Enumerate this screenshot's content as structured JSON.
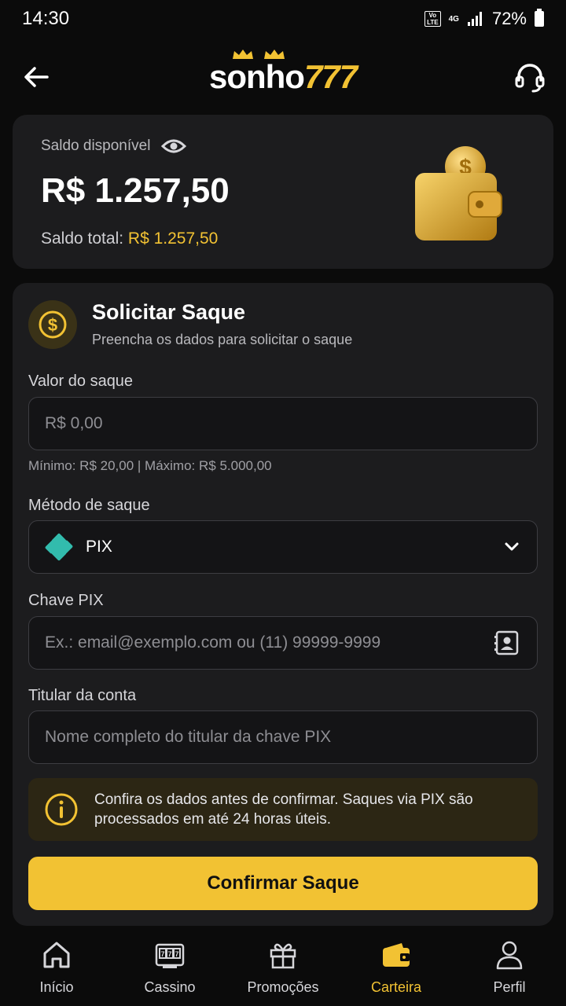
{
  "status_bar": {
    "time": "14:30",
    "volte": "Vo LTE",
    "network": "4G",
    "battery": "72%"
  },
  "header": {
    "logo_main": "sonho",
    "logo_num": "777"
  },
  "balance": {
    "label": "Saldo disponível",
    "amount": "R$ 1.257,50",
    "total_label": "Saldo total:",
    "total_value": "R$ 1.257,50"
  },
  "form": {
    "title": "Solicitar Saque",
    "subtitle": "Preencha os dados para solicitar o saque",
    "amount_label": "Valor do saque",
    "amount_placeholder": "R$ 0,00",
    "amount_hint": "Mínimo: R$ 20,00 | Máximo: R$ 5.000,00",
    "method_label": "Método de saque",
    "method_value": "PIX",
    "pix_label": "Chave PIX",
    "pix_placeholder": "Ex.: email@exemplo.com ou (11) 99999-9999",
    "holder_label": "Titular da conta",
    "holder_placeholder": "Nome completo do titular da chave PIX",
    "notice": "Confira os dados antes de confirmar. Saques via PIX são processados em até 24 horas úteis.",
    "confirm_label": "Confirmar Saque"
  },
  "nav": [
    {
      "label": "Início",
      "icon": "home-icon"
    },
    {
      "label": "Cassino",
      "icon": "slot-machine-icon"
    },
    {
      "label": "Promoções",
      "icon": "gift-icon"
    },
    {
      "label": "Carteira",
      "icon": "wallet-icon",
      "active": true
    },
    {
      "label": "Perfil",
      "icon": "user-icon"
    }
  ],
  "colors": {
    "accent": "#f2c233",
    "background": "#0b0b0b",
    "card": "#1c1c1e",
    "pix": "#32bcad"
  }
}
